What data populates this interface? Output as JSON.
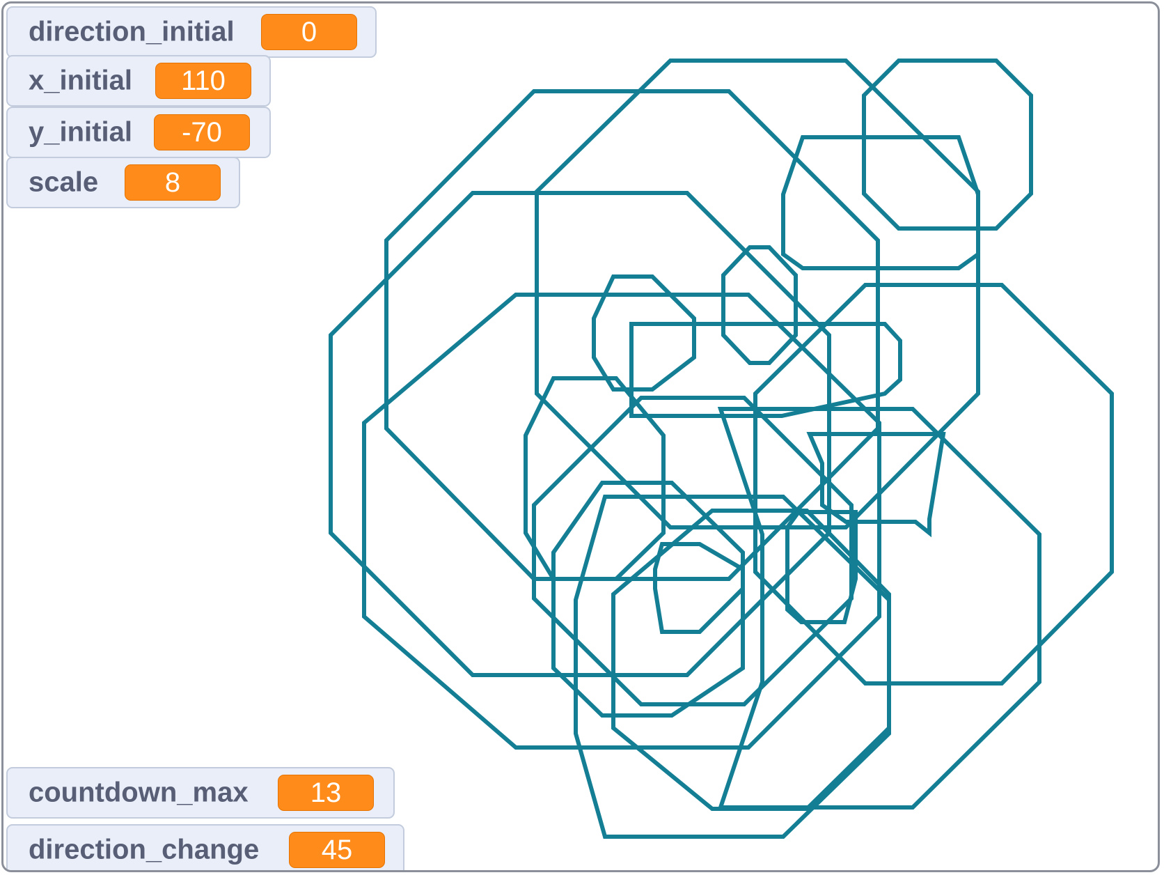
{
  "stage": {
    "pen_color": "#137e94"
  },
  "monitors": [
    {
      "name": "direction_initial",
      "label": "direction_initial",
      "value": "0"
    },
    {
      "name": "x_initial",
      "label": "x_initial",
      "value": "110"
    },
    {
      "name": "y_initial",
      "label": "y_initial",
      "value": "-70"
    },
    {
      "name": "scale",
      "label": "scale",
      "value": "8"
    },
    {
      "name": "countdown_max",
      "label": "countdown_max",
      "value": "13"
    },
    {
      "name": "direction_change",
      "label": "direction_change",
      "value": "45"
    }
  ],
  "colors": {
    "monitor_bg": "#e9eef8",
    "monitor_border": "#c3ccdd",
    "label_text": "#575e75",
    "value_bg": "#ff8c1a",
    "value_text": "#ffffff"
  }
}
